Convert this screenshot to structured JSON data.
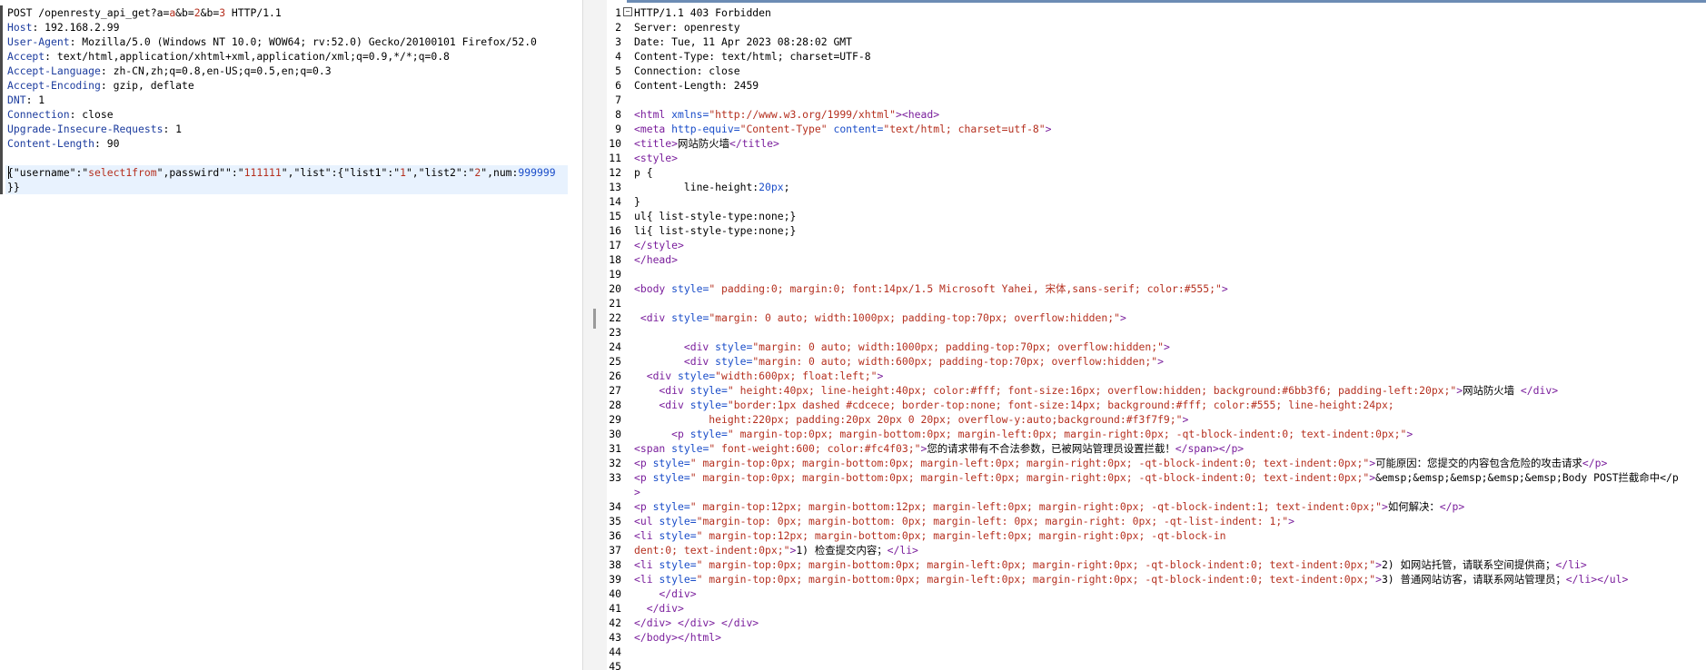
{
  "request": {
    "lines": [
      [
        {
          "t": "POST /openresty_api_get?a=",
          "c": ""
        },
        {
          "t": "a",
          "c": "str"
        },
        {
          "t": "&b=",
          "c": ""
        },
        {
          "t": "2",
          "c": "str"
        },
        {
          "t": "&b=",
          "c": ""
        },
        {
          "t": "3",
          "c": "str"
        },
        {
          "t": " HTTP/1.1",
          "c": ""
        }
      ],
      [
        {
          "t": "Host",
          "c": "hdrk"
        },
        {
          "t": ": 192.168.2.99",
          "c": ""
        }
      ],
      [
        {
          "t": "User-Agent",
          "c": "hdrk"
        },
        {
          "t": ": Mozilla/5.0 (Windows NT 10.0; WOW64; rv:52.0) Gecko/20100101 Firefox/52.0",
          "c": ""
        }
      ],
      [
        {
          "t": "Accept",
          "c": "hdrk"
        },
        {
          "t": ": text/html,application/xhtml+xml,application/xml;q=0.9,*/*;q=0.8",
          "c": ""
        }
      ],
      [
        {
          "t": "Accept-Language",
          "c": "hdrk"
        },
        {
          "t": ": zh-CN,zh;q=0.8,en-US;q=0.5,en;q=0.3",
          "c": ""
        }
      ],
      [
        {
          "t": "Accept-Encoding",
          "c": "hdrk"
        },
        {
          "t": ": gzip, deflate",
          "c": ""
        }
      ],
      [
        {
          "t": "DNT",
          "c": "hdrk"
        },
        {
          "t": ": 1",
          "c": ""
        }
      ],
      [
        {
          "t": "Connection",
          "c": "hdrk"
        },
        {
          "t": ": close",
          "c": ""
        }
      ],
      [
        {
          "t": "Upgrade-Insecure-Requests",
          "c": "hdrk"
        },
        {
          "t": ": 1",
          "c": ""
        }
      ],
      [
        {
          "t": "Content-Length",
          "c": "hdrk"
        },
        {
          "t": ": 90",
          "c": ""
        }
      ],
      [],
      [
        {
          "t": "{\"",
          "c": ""
        },
        {
          "t": "username",
          "c": ""
        },
        {
          "t": "\":\"",
          "c": ""
        },
        {
          "t": "select1from",
          "c": "str"
        },
        {
          "t": "\",passwird\"\":\"",
          "c": ""
        },
        {
          "t": "111111",
          "c": "str"
        },
        {
          "t": "\",\"list\":{\"list1\":\"",
          "c": ""
        },
        {
          "t": "1",
          "c": "str"
        },
        {
          "t": "\",\"list2\":\"",
          "c": ""
        },
        {
          "t": "2",
          "c": "str"
        },
        {
          "t": "\",num:",
          "c": ""
        },
        {
          "t": "999999",
          "c": "num"
        }
      ],
      [
        {
          "t": "}}",
          "c": ""
        }
      ]
    ]
  },
  "response": {
    "lines": [
      {
        "n": "1",
        "s": [
          {
            "t": "HTTP/1.1 403 Forbidden",
            "c": ""
          }
        ]
      },
      {
        "n": "2",
        "s": [
          {
            "t": "Server: openresty",
            "c": ""
          }
        ]
      },
      {
        "n": "3",
        "s": [
          {
            "t": "Date: Tue, 11 Apr 2023 08:28:02 GMT",
            "c": ""
          }
        ]
      },
      {
        "n": "4",
        "s": [
          {
            "t": "Content-Type: text/html; charset=UTF-8",
            "c": ""
          }
        ]
      },
      {
        "n": "5",
        "s": [
          {
            "t": "Connection: close",
            "c": ""
          }
        ]
      },
      {
        "n": "6",
        "s": [
          {
            "t": "Content-Length: 2459",
            "c": ""
          }
        ]
      },
      {
        "n": "7",
        "s": []
      },
      {
        "n": "8",
        "s": [
          {
            "t": "<html ",
            "c": "tag"
          },
          {
            "t": "xmlns=",
            "c": "attr"
          },
          {
            "t": "\"http://www.w3.org/1999/xhtml\"",
            "c": "val"
          },
          {
            "t": "><head>",
            "c": "tag"
          }
        ]
      },
      {
        "n": "9",
        "s": [
          {
            "t": "<meta ",
            "c": "tag"
          },
          {
            "t": "http-equiv=",
            "c": "attr"
          },
          {
            "t": "\"Content-Type\" ",
            "c": "val"
          },
          {
            "t": "content=",
            "c": "attr"
          },
          {
            "t": "\"text/html; charset=utf-8\"",
            "c": "val"
          },
          {
            "t": ">",
            "c": "tag"
          }
        ]
      },
      {
        "n": "10",
        "s": [
          {
            "t": "<title>",
            "c": "tag"
          },
          {
            "t": "网站防火墙",
            "c": ""
          },
          {
            "t": "</title>",
            "c": "tag"
          }
        ]
      },
      {
        "n": "11",
        "s": [
          {
            "t": "<style>",
            "c": "tag"
          }
        ]
      },
      {
        "n": "12",
        "s": [
          {
            "t": "p {",
            "c": ""
          }
        ]
      },
      {
        "n": "13",
        "s": [
          {
            "t": "        line-height:",
            "c": ""
          },
          {
            "t": "20px",
            "c": "attr"
          },
          {
            "t": ";",
            "c": ""
          }
        ]
      },
      {
        "n": "14",
        "s": [
          {
            "t": "}",
            "c": ""
          }
        ]
      },
      {
        "n": "15",
        "s": [
          {
            "t": "ul{ list-style-type:none;}",
            "c": ""
          }
        ]
      },
      {
        "n": "16",
        "s": [
          {
            "t": "li{ list-style-type:none;}",
            "c": ""
          }
        ]
      },
      {
        "n": "17",
        "s": [
          {
            "t": "</style>",
            "c": "tag"
          }
        ]
      },
      {
        "n": "18",
        "s": [
          {
            "t": "</head>",
            "c": "tag"
          }
        ]
      },
      {
        "n": "19",
        "s": []
      },
      {
        "n": "20",
        "s": [
          {
            "t": "<body ",
            "c": "tag"
          },
          {
            "t": "style=",
            "c": "attr"
          },
          {
            "t": "\" padding:0; margin:0; font:14px/1.5 Microsoft Yahei, 宋体,sans-serif; color:#555;\"",
            "c": "val"
          },
          {
            "t": ">",
            "c": "tag"
          }
        ]
      },
      {
        "n": "21",
        "s": []
      },
      {
        "n": "22",
        "s": [
          {
            "t": " <div ",
            "c": "tag"
          },
          {
            "t": "style=",
            "c": "attr"
          },
          {
            "t": "\"margin: 0 auto; width:1000px; padding-top:70px; overflow:hidden;\"",
            "c": "val"
          },
          {
            "t": ">",
            "c": "tag"
          }
        ]
      },
      {
        "n": "23",
        "s": []
      },
      {
        "n": "24",
        "s": [
          {
            "t": "        <div ",
            "c": "tag"
          },
          {
            "t": "style=",
            "c": "attr"
          },
          {
            "t": "\"margin: 0 auto; width:1000px; padding-top:70px; overflow:hidden;\"",
            "c": "val"
          },
          {
            "t": ">",
            "c": "tag"
          }
        ]
      },
      {
        "n": "25",
        "s": [
          {
            "t": "        <div ",
            "c": "tag"
          },
          {
            "t": "style=",
            "c": "attr"
          },
          {
            "t": "\"margin: 0 auto; width:600px; padding-top:70px; overflow:hidden;\"",
            "c": "val"
          },
          {
            "t": ">",
            "c": "tag"
          }
        ]
      },
      {
        "n": "26",
        "s": [
          {
            "t": "  <div ",
            "c": "tag"
          },
          {
            "t": "style=",
            "c": "attr"
          },
          {
            "t": "\"width:600px; float:left;\"",
            "c": "val"
          },
          {
            "t": ">",
            "c": "tag"
          }
        ]
      },
      {
        "n": "27",
        "s": [
          {
            "t": "    <div ",
            "c": "tag"
          },
          {
            "t": "style=",
            "c": "attr"
          },
          {
            "t": "\" height:40px; line-height:40px; color:#fff; font-size:16px; overflow:hidden; background:#6bb3f6; padding-left:20px;\"",
            "c": "val"
          },
          {
            "t": ">",
            "c": "tag"
          },
          {
            "t": "网站防火墙 ",
            "c": ""
          },
          {
            "t": "</div>",
            "c": "tag"
          }
        ]
      },
      {
        "n": "28",
        "s": [
          {
            "t": "    <div ",
            "c": "tag"
          },
          {
            "t": "style=",
            "c": "attr"
          },
          {
            "t": "\"border:1px dashed #cdcece; border-top:none; font-size:14px; background:#fff; color:#555; line-height:24px;",
            "c": "val"
          }
        ]
      },
      {
        "n": "29",
        "s": [
          {
            "t": "            height:220px; padding:20px 20px 0 20px; overflow-y:auto;background:#f3f7f9;\"",
            "c": "val"
          },
          {
            "t": ">",
            "c": "tag"
          }
        ]
      },
      {
        "n": "30",
        "s": [
          {
            "t": "      <p ",
            "c": "tag"
          },
          {
            "t": "style=",
            "c": "attr"
          },
          {
            "t": "\" margin-top:0px; margin-bottom:0px; margin-left:0px; margin-right:0px; -qt-block-indent:0; text-indent:0px;\"",
            "c": "val"
          },
          {
            "t": ">",
            "c": "tag"
          }
        ]
      },
      {
        "n": "31",
        "s": [
          {
            "t": "<span ",
            "c": "tag"
          },
          {
            "t": "style=",
            "c": "attr"
          },
          {
            "t": "\" font-weight:600; color:#fc4f03;\"",
            "c": "val"
          },
          {
            "t": ">",
            "c": "tag"
          },
          {
            "t": "您的请求带有不合法参数，已被网站管理员设置拦截！",
            "c": ""
          },
          {
            "t": "</span></p>",
            "c": "tag"
          }
        ]
      },
      {
        "n": "32",
        "s": [
          {
            "t": "<p ",
            "c": "tag"
          },
          {
            "t": "style=",
            "c": "attr"
          },
          {
            "t": "\" margin-top:0px; margin-bottom:0px; margin-left:0px; margin-right:0px; -qt-block-indent:0; text-indent:0px;\"",
            "c": "val"
          },
          {
            "t": ">",
            "c": "tag"
          },
          {
            "t": "可能原因：您提交的内容包含危险的攻击请求",
            "c": ""
          },
          {
            "t": "</p>",
            "c": "tag"
          }
        ]
      },
      {
        "n": "33",
        "s": [
          {
            "t": "<p ",
            "c": "tag"
          },
          {
            "t": "style=",
            "c": "attr"
          },
          {
            "t": "\" margin-top:0px; margin-bottom:0px; margin-left:0px; margin-right:0px; -qt-block-indent:0; text-indent:0px;\"",
            "c": "val"
          },
          {
            "t": ">",
            "c": "tag"
          },
          {
            "t": "&emsp;&emsp;&emsp;&emsp;&emsp;Body POST拦截命中</p",
            "c": ""
          }
        ]
      },
      {
        "n": "",
        "s": [
          {
            "t": ">",
            "c": "tag"
          }
        ]
      },
      {
        "n": "34",
        "s": [
          {
            "t": "<p ",
            "c": "tag"
          },
          {
            "t": "style=",
            "c": "attr"
          },
          {
            "t": "\" margin-top:12px; margin-bottom:12px; margin-left:0px; margin-right:0px; -qt-block-indent:1; text-indent:0px;\"",
            "c": "val"
          },
          {
            "t": ">",
            "c": "tag"
          },
          {
            "t": "如何解决：",
            "c": ""
          },
          {
            "t": "</p>",
            "c": "tag"
          }
        ]
      },
      {
        "n": "35",
        "s": [
          {
            "t": "<ul ",
            "c": "tag"
          },
          {
            "t": "style=",
            "c": "attr"
          },
          {
            "t": "\"margin-top: 0px; margin-bottom: 0px; margin-left: 0px; margin-right: 0px; -qt-list-indent: 1;\"",
            "c": "val"
          },
          {
            "t": ">",
            "c": "tag"
          }
        ]
      },
      {
        "n": "36",
        "s": [
          {
            "t": "<li ",
            "c": "tag"
          },
          {
            "t": "style=",
            "c": "attr"
          },
          {
            "t": "\" margin-top:12px; margin-bottom:0px; margin-left:0px; margin-right:0px; -qt-block-in",
            "c": "val"
          }
        ]
      },
      {
        "n": "37",
        "s": [
          {
            "t": "dent:0; text-indent:0px;\"",
            "c": "val"
          },
          {
            "t": ">",
            "c": "tag"
          },
          {
            "t": "1) 检查提交内容；",
            "c": ""
          },
          {
            "t": "</li>",
            "c": "tag"
          }
        ]
      },
      {
        "n": "38",
        "s": [
          {
            "t": "<li ",
            "c": "tag"
          },
          {
            "t": "style=",
            "c": "attr"
          },
          {
            "t": "\" margin-top:0px; margin-bottom:0px; margin-left:0px; margin-right:0px; -qt-block-indent:0; text-indent:0px;\"",
            "c": "val"
          },
          {
            "t": ">",
            "c": "tag"
          },
          {
            "t": "2) 如网站托管，请联系空间提供商；",
            "c": ""
          },
          {
            "t": "</li>",
            "c": "tag"
          }
        ]
      },
      {
        "n": "39",
        "s": [
          {
            "t": "<li ",
            "c": "tag"
          },
          {
            "t": "style=",
            "c": "attr"
          },
          {
            "t": "\" margin-top:0px; margin-bottom:0px; margin-left:0px; margin-right:0px; -qt-block-indent:0; text-indent:0px;\"",
            "c": "val"
          },
          {
            "t": ">",
            "c": "tag"
          },
          {
            "t": "3) 普通网站访客，请联系网站管理员；",
            "c": ""
          },
          {
            "t": "</li></ul>",
            "c": "tag"
          }
        ]
      },
      {
        "n": "40",
        "s": [
          {
            "t": "    </div>",
            "c": "tag"
          }
        ]
      },
      {
        "n": "41",
        "s": [
          {
            "t": "  </div>",
            "c": "tag"
          }
        ]
      },
      {
        "n": "42",
        "s": [
          {
            "t": "</div> </div> </div>",
            "c": "tag"
          }
        ]
      },
      {
        "n": "43",
        "s": [
          {
            "t": "</body></html>",
            "c": "tag"
          }
        ]
      },
      {
        "n": "44",
        "s": []
      },
      {
        "n": "45",
        "s": []
      }
    ]
  },
  "icons": {
    "scroll_up": "scroll-up-arrow-icon",
    "scroll_down": "scroll-down-arrow-icon",
    "fold": "fold-minus-icon"
  },
  "colors": {
    "tag": "#7a1e9c",
    "attr": "#1a4dc9",
    "value": "#b5301f",
    "header_key": "#1c3c9e"
  }
}
